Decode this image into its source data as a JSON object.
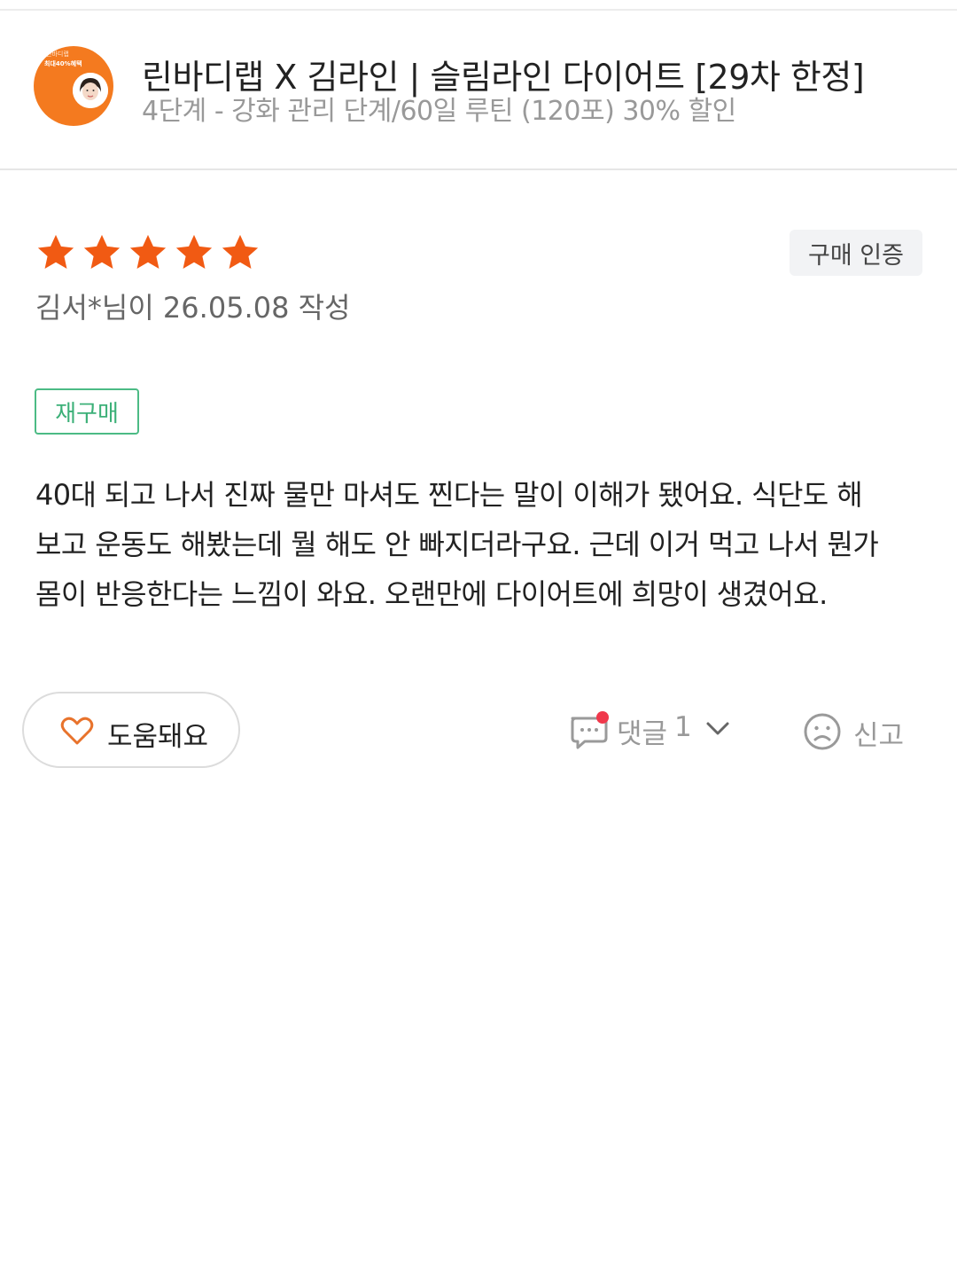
{
  "product": {
    "thumbnail_text_1": "린바디랩",
    "thumbnail_text_2": "최대40%혜택",
    "title": "린바디랩 X 김라인 | 슬림라인 다이어트 [29차 한정]",
    "option": "4단계 - 강화 관리 단계/60일 루틴 (120포) 30% 할인"
  },
  "review": {
    "rating": 5,
    "rating_max": 5,
    "star_color": "#f15a13",
    "verified_label": "구매 인증",
    "author_line": "김서*님이 26.05.08 작성",
    "tag": "재구매",
    "body_lines": [
      "40대 되고 나서 진짜 물만 마셔도 찐다는 말이 이해가 됐어요. 식단도 해",
      "보고 운동도 해봤는데 뭘 해도 안 빠지더라구요. 근데 이거 먹고 나서 뭔가",
      "몸이 반응한다는 느낌이 와요. 오랜만에 다이어트에 희망이 생겼어요."
    ]
  },
  "actions": {
    "helpful_label": "도움돼요",
    "comment_label": "댓글",
    "comment_count": "1",
    "report_label": "신고",
    "icons": [
      "heart-icon",
      "comment-icon",
      "chevron-down-icon",
      "sad-face-icon"
    ],
    "accent_color": "#e8732c",
    "notification_dot_color": "#f0384b"
  }
}
